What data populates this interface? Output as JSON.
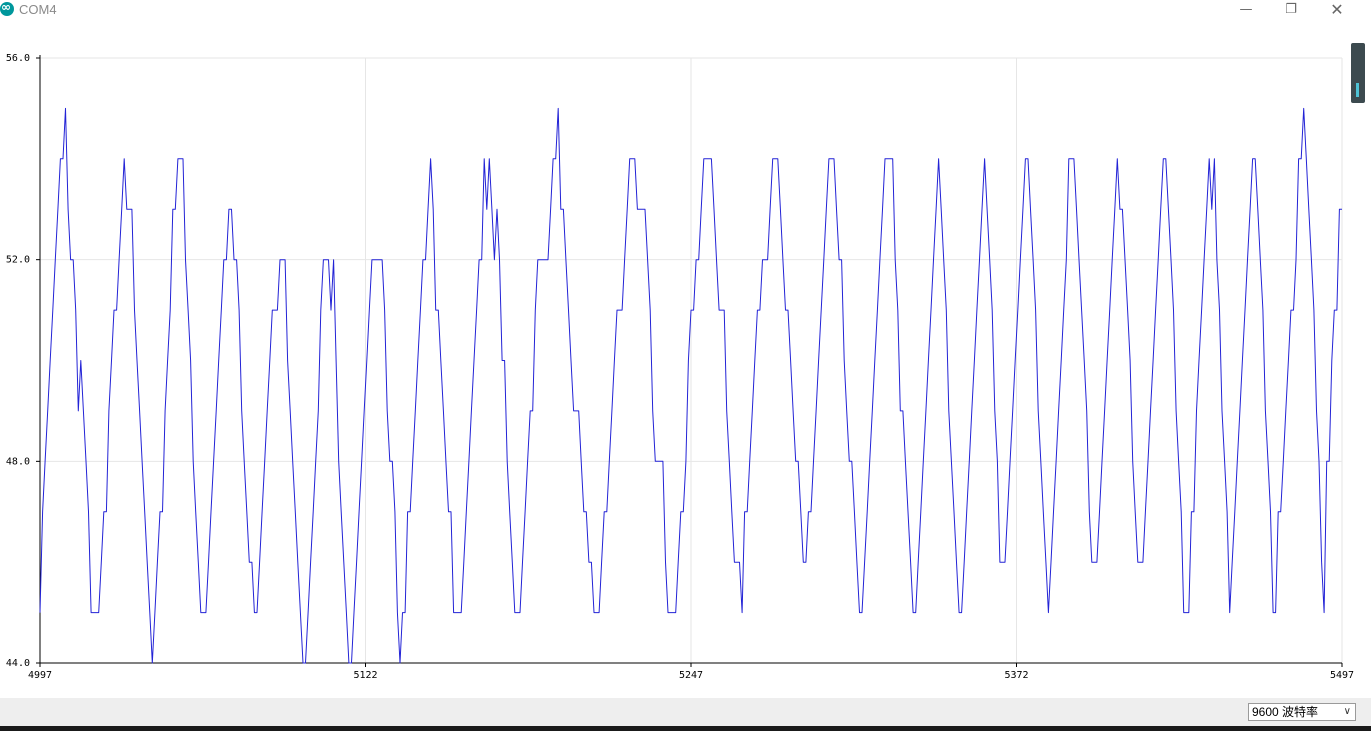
{
  "window": {
    "title": "COM4",
    "minimize_glyph": "—",
    "maximize_glyph": "❐",
    "close_glyph": "✕"
  },
  "footer": {
    "baud_rate": "9600  波特率"
  },
  "colors": {
    "line": "#2323d6",
    "grid": "#e6e6e6",
    "axis": "#000000"
  },
  "chart_data": {
    "type": "line",
    "title": "",
    "xlabel": "",
    "ylabel": "",
    "xlim": [
      4997,
      5497
    ],
    "ylim": [
      44.0,
      56.0
    ],
    "x_ticks": [
      "4997",
      "5122",
      "5247",
      "5372",
      "5497"
    ],
    "y_ticks": [
      "44.0",
      "48.0",
      "52.0",
      "56.0"
    ],
    "grid": true,
    "series": [
      {
        "values": [
          45,
          47,
          48,
          49,
          50,
          51,
          52,
          53,
          54,
          54,
          55,
          53,
          52,
          52,
          51,
          49,
          50,
          49,
          48,
          47,
          45,
          45,
          45,
          45,
          46,
          47,
          47,
          49,
          50,
          51,
          51,
          52,
          53,
          54,
          53,
          53,
          53,
          51,
          50,
          49,
          48,
          47,
          46,
          45,
          44,
          45,
          46,
          47,
          47,
          49,
          50,
          51,
          53,
          53,
          54,
          54,
          54,
          52,
          51,
          50,
          48,
          47,
          46,
          45,
          45,
          45,
          46,
          47,
          48,
          49,
          50,
          51,
          52,
          52,
          53,
          53,
          52,
          52,
          51,
          49,
          48,
          47,
          46,
          46,
          45,
          45,
          46,
          47,
          48,
          49,
          50,
          51,
          51,
          51,
          52,
          52,
          52,
          50,
          49,
          48,
          47,
          46,
          45,
          44,
          44,
          45,
          46,
          47,
          48,
          49,
          51,
          52,
          52,
          52,
          51,
          52,
          50,
          48,
          47,
          46,
          45,
          44,
          44,
          45,
          46,
          47,
          48,
          49,
          50,
          51,
          52,
          52,
          52,
          52,
          52,
          51,
          49,
          48,
          48,
          47,
          45,
          44,
          45,
          45,
          47,
          47,
          48,
          49,
          50,
          51,
          52,
          52,
          53,
          54,
          53,
          51,
          51,
          50,
          49,
          48,
          47,
          47,
          45,
          45,
          45,
          45,
          46,
          47,
          48,
          49,
          50,
          51,
          52,
          52,
          54,
          53,
          54,
          53,
          52,
          53,
          52,
          50,
          50,
          48,
          47,
          46,
          45,
          45,
          45,
          46,
          47,
          48,
          49,
          49,
          51,
          52,
          52,
          52,
          52,
          52,
          53,
          54,
          54,
          55,
          53,
          53,
          52,
          51,
          50,
          49,
          49,
          49,
          48,
          47,
          47,
          46,
          46,
          45,
          45,
          45,
          46,
          47,
          47,
          48,
          49,
          50,
          51,
          51,
          51,
          52,
          53,
          54,
          54,
          54,
          53,
          53,
          53,
          53,
          52,
          51,
          49,
          48,
          48,
          48,
          48,
          46,
          45,
          45,
          45,
          45,
          46,
          47,
          47,
          48,
          50,
          51,
          51,
          52,
          52,
          53,
          54,
          54,
          54,
          54,
          53,
          52,
          51,
          51,
          51,
          49,
          48,
          47,
          46,
          46,
          46,
          45,
          47,
          47,
          48,
          49,
          50,
          51,
          51,
          52,
          52,
          52,
          53,
          54,
          54,
          54,
          53,
          52,
          51,
          51,
          50,
          49,
          48,
          48,
          47,
          46,
          46,
          47,
          47,
          48,
          49,
          50,
          51,
          52,
          53,
          54,
          54,
          54,
          53,
          52,
          52,
          50,
          49,
          48,
          48,
          47,
          46,
          45,
          45,
          46,
          47,
          48,
          49,
          50,
          51,
          52,
          53,
          54,
          54,
          54,
          54,
          52,
          51,
          49,
          49,
          48,
          47,
          46,
          45,
          45,
          46,
          47,
          48,
          49,
          50,
          51,
          52,
          53,
          54,
          53,
          52,
          51,
          49,
          48,
          47,
          46,
          45,
          45,
          46,
          47,
          48,
          49,
          50,
          51,
          52,
          53,
          54,
          53,
          52,
          51,
          49,
          48,
          46,
          46,
          46,
          47,
          48,
          49,
          50,
          51,
          52,
          53,
          54,
          54,
          53,
          52,
          51,
          49,
          48,
          47,
          46,
          45,
          46,
          47,
          48,
          49,
          50,
          51,
          52,
          54,
          54,
          54,
          53,
          52,
          51,
          50,
          49,
          47,
          46,
          46,
          46,
          47,
          48,
          49,
          50,
          51,
          52,
          53,
          54,
          53,
          53,
          52,
          51,
          50,
          48,
          47,
          46,
          46,
          46,
          47,
          48,
          49,
          50,
          51,
          52,
          53,
          54,
          54,
          53,
          52,
          51,
          49,
          48,
          47,
          45,
          45,
          45,
          47,
          47,
          49,
          50,
          51,
          52,
          53,
          54,
          53,
          54,
          52,
          51,
          49,
          48,
          47,
          45,
          46,
          47,
          48,
          49,
          50,
          51,
          52,
          53,
          54,
          54,
          53,
          52,
          51,
          49,
          48,
          47,
          45,
          45,
          47,
          47,
          48,
          49,
          50,
          51,
          51,
          52,
          54,
          54,
          55,
          54,
          53,
          52,
          51,
          49,
          48,
          46,
          45,
          48,
          48,
          50,
          51,
          51,
          53,
          53
        ]
      }
    ]
  }
}
